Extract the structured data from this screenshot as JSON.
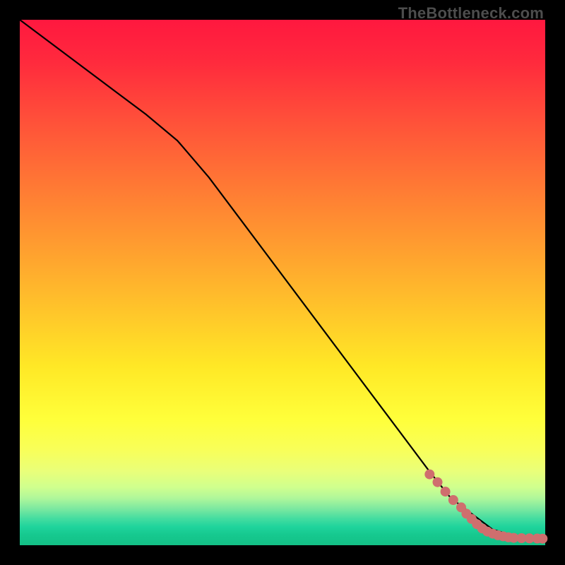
{
  "watermark": "TheBottleneck.com",
  "chart_data": {
    "type": "line",
    "title": "",
    "xlabel": "",
    "ylabel": "",
    "xlim": [
      0,
      100
    ],
    "ylim": [
      0,
      100
    ],
    "grid": false,
    "series": [
      {
        "name": "curve",
        "color": "#000000",
        "x": [
          0,
          8,
          16,
          24,
          30,
          36,
          42,
          48,
          54,
          60,
          66,
          72,
          78,
          82,
          86,
          90,
          94,
          98,
          100
        ],
        "y": [
          100,
          94,
          88,
          82,
          77,
          70,
          62,
          54,
          46,
          38,
          30,
          22,
          14,
          9,
          6,
          3,
          1.8,
          1.3,
          1.2
        ]
      }
    ],
    "markers": [
      {
        "name": "points",
        "color": "#cf6e6e",
        "radius": 7,
        "x": [
          78,
          79.5,
          81,
          82.5,
          84,
          85,
          86,
          87,
          88,
          89,
          90,
          91,
          92,
          93,
          94,
          95.5,
          97,
          98.5,
          99.5
        ],
        "y": [
          13.5,
          12,
          10.2,
          8.6,
          7.2,
          6.0,
          5.0,
          4.0,
          3.2,
          2.6,
          2.2,
          1.9,
          1.7,
          1.5,
          1.4,
          1.35,
          1.3,
          1.28,
          1.25
        ]
      }
    ]
  }
}
